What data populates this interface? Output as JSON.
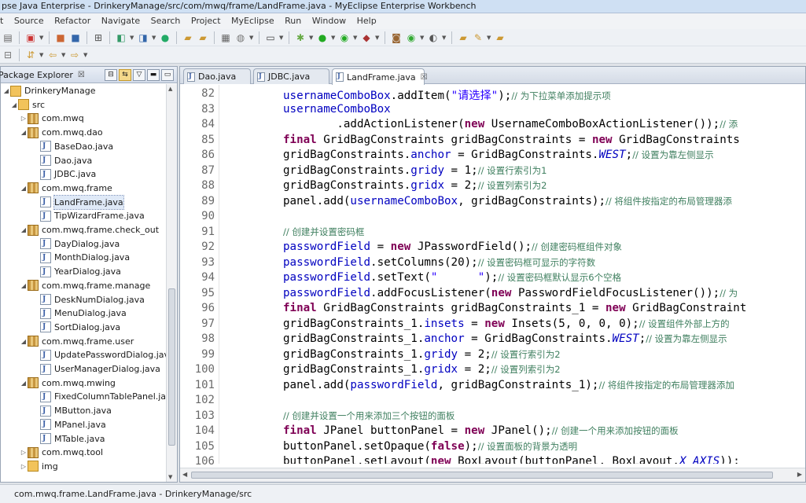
{
  "window": {
    "title": "pse Java Enterprise - DrinkeryManage/src/com/mwq/frame/LandFrame.java - MyEclipse Enterprise Workbench"
  },
  "menu": [
    "t",
    "Source",
    "Refactor",
    "Navigate",
    "Search",
    "Project",
    "MyEclipse",
    "Run",
    "Window",
    "Help"
  ],
  "package_explorer": {
    "title": "Package Explorer",
    "close_glyph": "☒",
    "items": [
      {
        "label": "DrinkeryManage",
        "kind": "project",
        "expanded": true
      },
      {
        "label": "src",
        "kind": "src",
        "expanded": true
      },
      {
        "label": "com.mwq",
        "kind": "package",
        "expanded": false
      },
      {
        "label": "com.mwq.dao",
        "kind": "package",
        "expanded": true
      },
      {
        "label": "BaseDao.java",
        "kind": "java"
      },
      {
        "label": "Dao.java",
        "kind": "java"
      },
      {
        "label": "JDBC.java",
        "kind": "java"
      },
      {
        "label": "com.mwq.frame",
        "kind": "package",
        "expanded": true
      },
      {
        "label": "LandFrame.java",
        "kind": "java",
        "selected": true
      },
      {
        "label": "TipWizardFrame.java",
        "kind": "java"
      },
      {
        "label": "com.mwq.frame.check_out",
        "kind": "package",
        "expanded": true
      },
      {
        "label": "DayDialog.java",
        "kind": "java"
      },
      {
        "label": "MonthDialog.java",
        "kind": "java"
      },
      {
        "label": "YearDialog.java",
        "kind": "java"
      },
      {
        "label": "com.mwq.frame.manage",
        "kind": "package",
        "expanded": true
      },
      {
        "label": "DeskNumDialog.java",
        "kind": "java"
      },
      {
        "label": "MenuDialog.java",
        "kind": "java"
      },
      {
        "label": "SortDialog.java",
        "kind": "java"
      },
      {
        "label": "com.mwq.frame.user",
        "kind": "package",
        "expanded": true
      },
      {
        "label": "UpdatePasswordDialog.java",
        "kind": "java"
      },
      {
        "label": "UserManagerDialog.java",
        "kind": "java"
      },
      {
        "label": "com.mwq.mwing",
        "kind": "package",
        "expanded": true
      },
      {
        "label": "FixedColumnTablePanel.java",
        "kind": "java"
      },
      {
        "label": "MButton.java",
        "kind": "java"
      },
      {
        "label": "MPanel.java",
        "kind": "java"
      },
      {
        "label": "MTable.java",
        "kind": "java"
      },
      {
        "label": "com.mwq.tool",
        "kind": "package",
        "expanded": false
      },
      {
        "label": "img",
        "kind": "folder",
        "expanded": false
      }
    ]
  },
  "editor": {
    "tabs": [
      {
        "label": "Dao.java",
        "active": false
      },
      {
        "label": "JDBC.java",
        "active": false
      },
      {
        "label": "LandFrame.java",
        "active": true
      }
    ],
    "tab_close_glyph": "☒",
    "lines": [
      {
        "n": "82",
        "t": [
          [
            "fd",
            "usernameComboBox"
          ],
          [
            "",
            "."
          ],
          [
            "",
            "addItem("
          ],
          [
            "st",
            "\"请选择\""
          ],
          [
            "",
            ");"
          ],
          [
            "cm",
            "// 为下拉菜单添加提示项"
          ]
        ]
      },
      {
        "n": "83",
        "t": [
          [
            "fd",
            "usernameComboBox"
          ]
        ]
      },
      {
        "n": "84",
        "t": [
          [
            "",
            "        .addActionListener("
          ],
          [
            "kw",
            "new"
          ],
          [
            "",
            " UsernameComboBoxActionListener());"
          ],
          [
            "cm",
            "// 添"
          ]
        ]
      },
      {
        "n": "85",
        "t": [
          [
            "kw",
            "final"
          ],
          [
            "",
            " GridBagConstraints gridBagConstraints = "
          ],
          [
            "kw",
            "new"
          ],
          [
            "",
            " GridBagConstraints"
          ]
        ]
      },
      {
        "n": "86",
        "t": [
          [
            "",
            "gridBagConstraints."
          ],
          [
            "fd",
            "anchor"
          ],
          [
            "",
            " = GridBagConstraints."
          ],
          [
            "it",
            "WEST"
          ],
          [
            "",
            ";"
          ],
          [
            "cm",
            "// 设置为靠左侧显示"
          ]
        ]
      },
      {
        "n": "87",
        "t": [
          [
            "",
            "gridBagConstraints."
          ],
          [
            "fd",
            "gridy"
          ],
          [
            "",
            " = 1;"
          ],
          [
            "cm",
            "// 设置行索引为1"
          ]
        ]
      },
      {
        "n": "88",
        "t": [
          [
            "",
            "gridBagConstraints."
          ],
          [
            "fd",
            "gridx"
          ],
          [
            "",
            " = 2;"
          ],
          [
            "cm",
            "// 设置列索引为2"
          ]
        ]
      },
      {
        "n": "89",
        "t": [
          [
            "",
            "panel.add("
          ],
          [
            "fd",
            "usernameComboBox"
          ],
          [
            "",
            ", gridBagConstraints);"
          ],
          [
            "cm",
            "// 将组件按指定的布局管理器添"
          ]
        ]
      },
      {
        "n": "90",
        "t": []
      },
      {
        "n": "91",
        "t": [
          [
            "cm",
            "// 创建并设置密码框"
          ]
        ]
      },
      {
        "n": "92",
        "t": [
          [
            "fd",
            "passwordField"
          ],
          [
            "",
            " = "
          ],
          [
            "kw",
            "new"
          ],
          [
            "",
            " JPasswordField();"
          ],
          [
            "cm",
            "// 创建密码框组件对象"
          ]
        ]
      },
      {
        "n": "93",
        "t": [
          [
            "fd",
            "passwordField"
          ],
          [
            "",
            ".setColumns(20);"
          ],
          [
            "cm",
            "// 设置密码框可显示的字符数"
          ]
        ]
      },
      {
        "n": "94",
        "t": [
          [
            "fd",
            "passwordField"
          ],
          [
            "",
            ".setText("
          ],
          [
            "st",
            "\"      \""
          ],
          [
            "",
            ");"
          ],
          [
            "cm",
            "// 设置密码框默认显示6个空格"
          ]
        ]
      },
      {
        "n": "95",
        "t": [
          [
            "fd",
            "passwordField"
          ],
          [
            "",
            ".addFocusListener("
          ],
          [
            "kw",
            "new"
          ],
          [
            "",
            " PasswordFieldFocusListener());"
          ],
          [
            "cm",
            "// 为"
          ]
        ]
      },
      {
        "n": "96",
        "t": [
          [
            "kw",
            "final"
          ],
          [
            "",
            " GridBagConstraints gridBagConstraints_1 = "
          ],
          [
            "kw",
            "new"
          ],
          [
            "",
            " GridBagConstraint"
          ]
        ]
      },
      {
        "n": "97",
        "t": [
          [
            "",
            "gridBagConstraints_1."
          ],
          [
            "fd",
            "insets"
          ],
          [
            "",
            " = "
          ],
          [
            "kw",
            "new"
          ],
          [
            "",
            " Insets(5, 0, 0, 0);"
          ],
          [
            "cm",
            "// 设置组件外部上方的"
          ]
        ]
      },
      {
        "n": "98",
        "t": [
          [
            "",
            "gridBagConstraints_1."
          ],
          [
            "fd",
            "anchor"
          ],
          [
            "",
            " = GridBagConstraints."
          ],
          [
            "it",
            "WEST"
          ],
          [
            "",
            ";"
          ],
          [
            "cm",
            "// 设置为靠左侧显示"
          ]
        ]
      },
      {
        "n": "99",
        "t": [
          [
            "",
            "gridBagConstraints_1."
          ],
          [
            "fd",
            "gridy"
          ],
          [
            "",
            " = 2;"
          ],
          [
            "cm",
            "// 设置行索引为2"
          ]
        ]
      },
      {
        "n": "100",
        "t": [
          [
            "",
            "gridBagConstraints_1."
          ],
          [
            "fd",
            "gridx"
          ],
          [
            "",
            " = 2;"
          ],
          [
            "cm",
            "// 设置列索引为2"
          ]
        ]
      },
      {
        "n": "101",
        "t": [
          [
            "",
            "panel.add("
          ],
          [
            "fd",
            "passwordField"
          ],
          [
            "",
            ", gridBagConstraints_1);"
          ],
          [
            "cm",
            "// 将组件按指定的布局管理器添加"
          ]
        ]
      },
      {
        "n": "102",
        "t": []
      },
      {
        "n": "103",
        "t": [
          [
            "cm",
            "// 创建并设置一个用来添加三个按钮的面板"
          ]
        ]
      },
      {
        "n": "104",
        "t": [
          [
            "kw",
            "final"
          ],
          [
            "",
            " JPanel buttonPanel = "
          ],
          [
            "kw",
            "new"
          ],
          [
            "",
            " JPanel();"
          ],
          [
            "cm",
            "// 创建一个用来添加按钮的面板"
          ]
        ]
      },
      {
        "n": "105",
        "t": [
          [
            "",
            "buttonPanel.setOpaque("
          ],
          [
            "kw",
            "false"
          ],
          [
            "",
            ");"
          ],
          [
            "cm",
            "// 设置面板的背景为透明"
          ]
        ]
      },
      {
        "n": "106",
        "t": [
          [
            "",
            "buttonPanel.setLayout("
          ],
          [
            "kw",
            "new"
          ],
          [
            "",
            " BoxLayout(buttonPanel, BoxLayout."
          ],
          [
            "it",
            "X_AXIS"
          ],
          [
            "",
            "));"
          ]
        ]
      }
    ]
  },
  "status": {
    "text": "com.mwq.frame.LandFrame.java - DrinkeryManage/src"
  }
}
